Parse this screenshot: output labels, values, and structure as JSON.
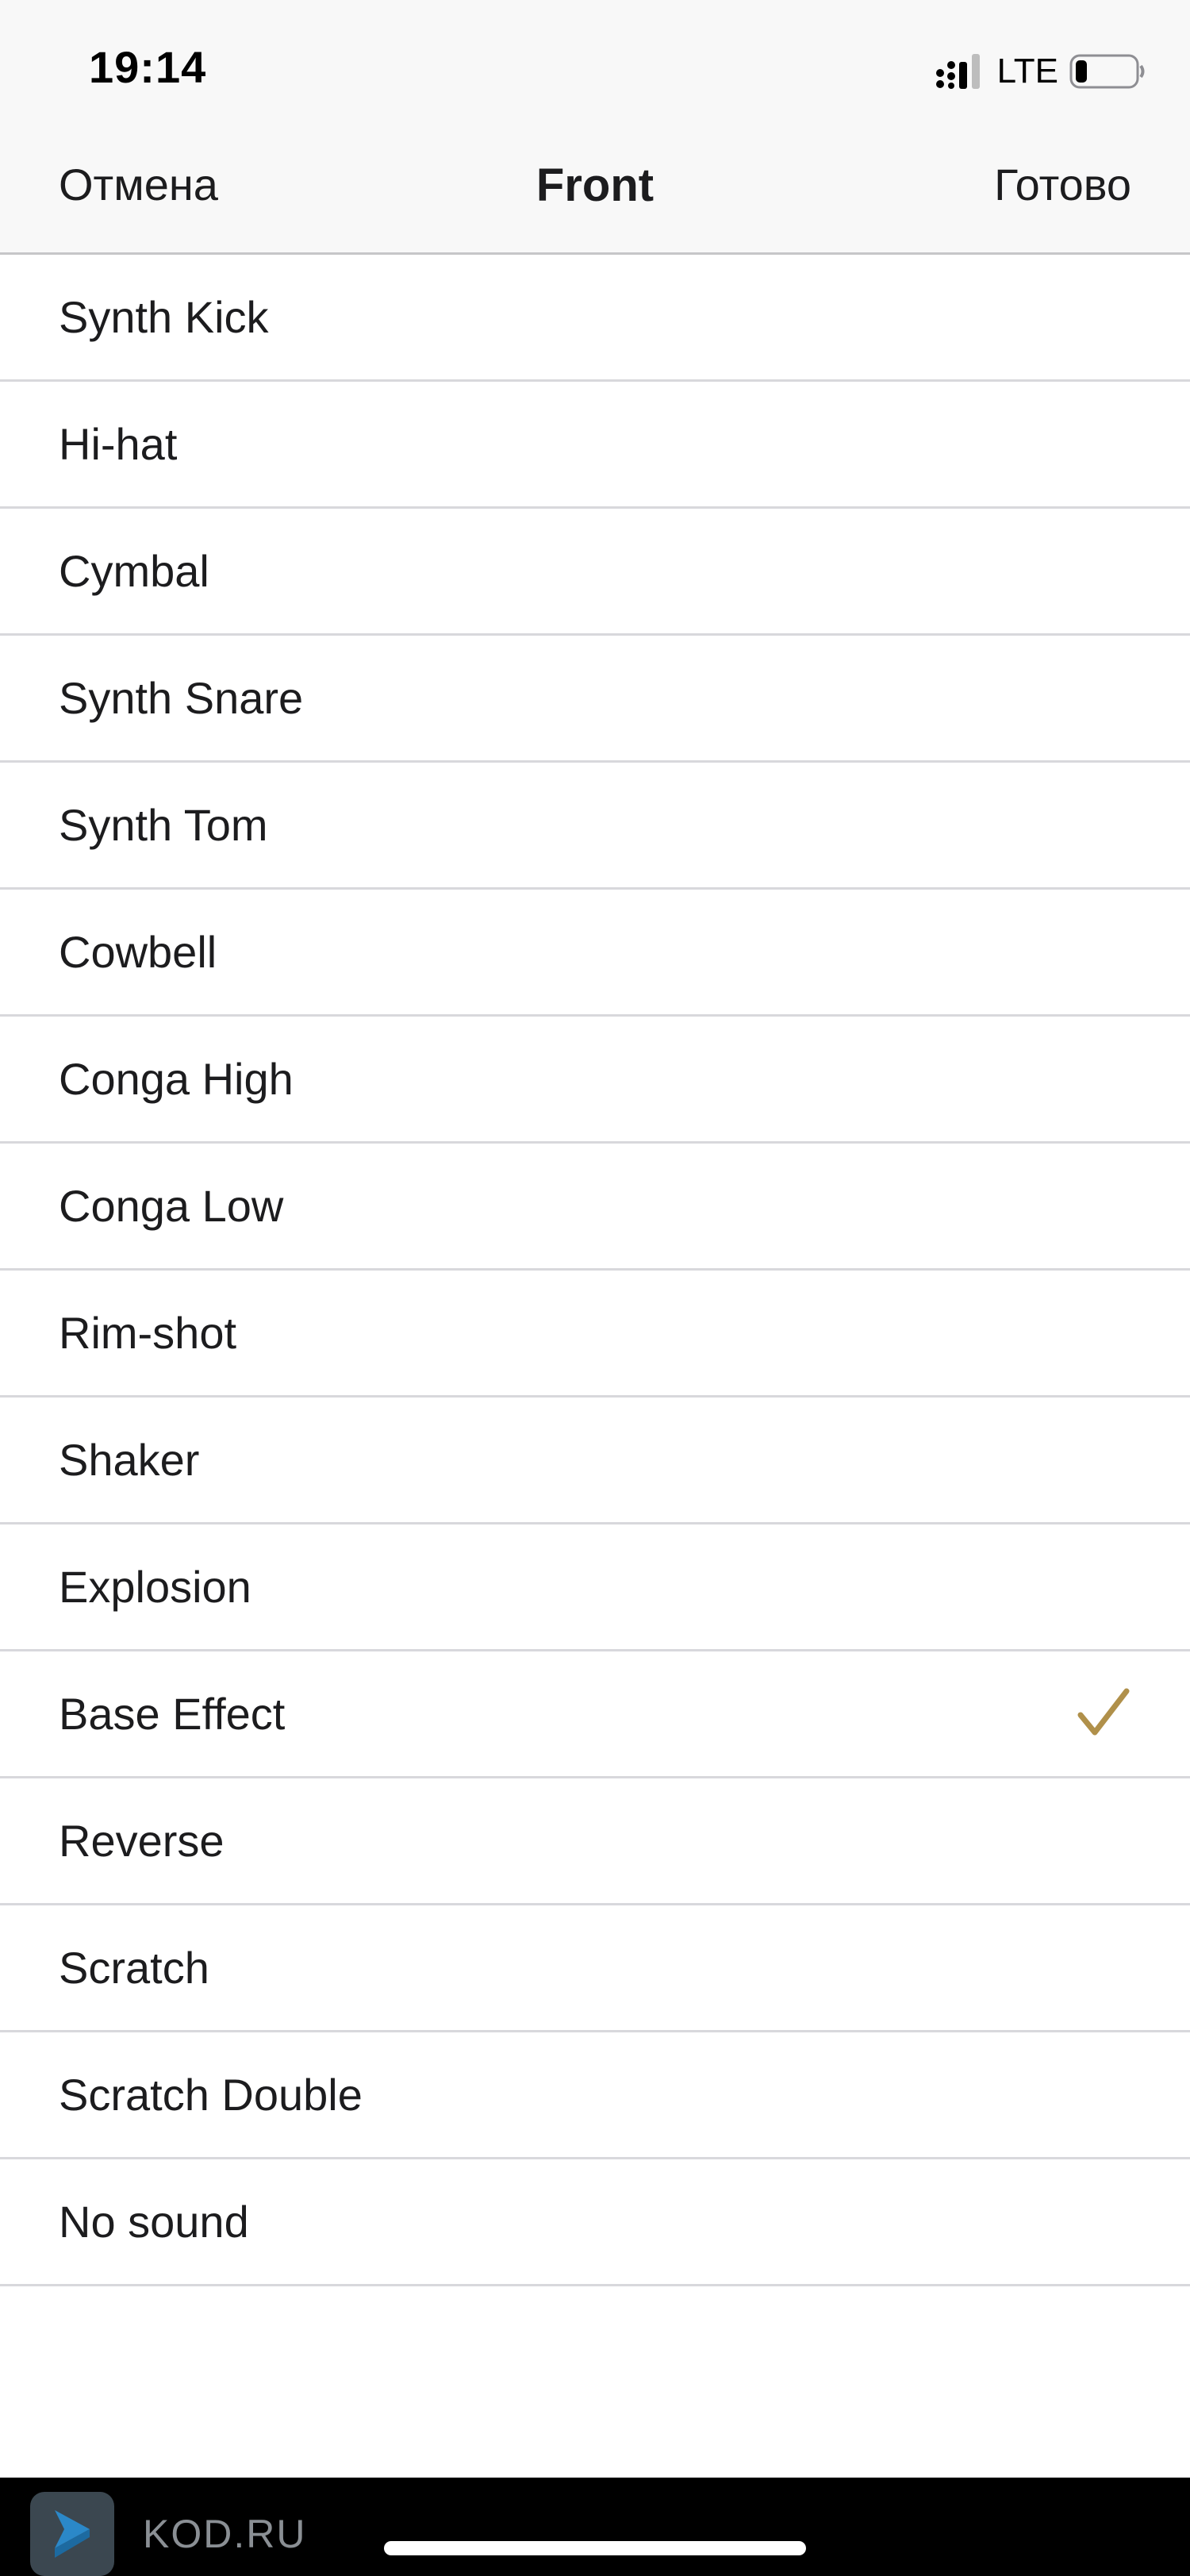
{
  "status_bar": {
    "time": "19:14",
    "network": "LTE",
    "icons": [
      "cellular-signal-icon",
      "battery-icon"
    ]
  },
  "nav": {
    "cancel_label": "Отмена",
    "title": "Front",
    "done_label": "Готово"
  },
  "sounds": [
    {
      "label": "Synth Kick",
      "selected": false
    },
    {
      "label": "Hi-hat",
      "selected": false
    },
    {
      "label": "Cymbal",
      "selected": false
    },
    {
      "label": "Synth Snare",
      "selected": false
    },
    {
      "label": "Synth Tom",
      "selected": false
    },
    {
      "label": "Cowbell",
      "selected": false
    },
    {
      "label": "Conga High",
      "selected": false
    },
    {
      "label": "Conga Low",
      "selected": false
    },
    {
      "label": "Rim-shot",
      "selected": false
    },
    {
      "label": "Shaker",
      "selected": false
    },
    {
      "label": "Explosion",
      "selected": false
    },
    {
      "label": "Base Effect",
      "selected": true
    },
    {
      "label": "Reverse",
      "selected": false
    },
    {
      "label": "Scratch",
      "selected": false
    },
    {
      "label": "Scratch Double",
      "selected": false
    },
    {
      "label": "No sound",
      "selected": false
    }
  ],
  "watermark": {
    "text": "KOD.RU"
  },
  "colors": {
    "checkmark": "#b0904a",
    "bar_background": "#f8f8f8",
    "separator": "#d8d8dc"
  }
}
